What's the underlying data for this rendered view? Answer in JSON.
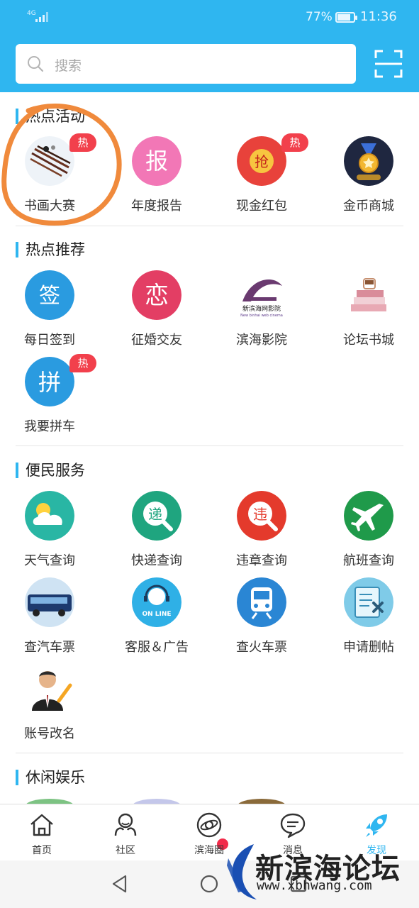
{
  "status_bar": {
    "network": "4G",
    "battery": "77%",
    "time": "11:36"
  },
  "search": {
    "placeholder": "搜索",
    "icon": "search-icon",
    "scan_icon": "scan-icon"
  },
  "sections": [
    {
      "title": "热点活动",
      "items": [
        {
          "label": "书画大赛",
          "icon": "calligraphy-brushes-icon",
          "badge": "热"
        },
        {
          "label": "年度报告",
          "icon": "report-icon",
          "glyph": "报"
        },
        {
          "label": "现金红包",
          "icon": "red-envelope-icon",
          "glyph": "抢",
          "badge": "热"
        },
        {
          "label": "金币商城",
          "icon": "gold-medal-icon"
        }
      ]
    },
    {
      "title": "热点推荐",
      "items": [
        {
          "label": "每日签到",
          "icon": "checkin-icon",
          "glyph": "签"
        },
        {
          "label": "征婚交友",
          "icon": "dating-icon",
          "glyph": "恋"
        },
        {
          "label": "滨海影院",
          "icon": "cinema-logo-icon",
          "caption": "新滨海网影院",
          "subcaption": "New binhai web cinema"
        },
        {
          "label": "论坛书城",
          "icon": "books-icon"
        },
        {
          "label": "我要拼车",
          "icon": "carpool-icon",
          "glyph": "拼",
          "badge": "热"
        }
      ]
    },
    {
      "title": "便民服务",
      "items": [
        {
          "label": "天气查询",
          "icon": "weather-icon"
        },
        {
          "label": "快递查询",
          "icon": "express-icon",
          "glyph": "递"
        },
        {
          "label": "违章查询",
          "icon": "violation-icon",
          "glyph": "违"
        },
        {
          "label": "航班查询",
          "icon": "airplane-icon"
        },
        {
          "label": "查汽车票",
          "icon": "bus-icon"
        },
        {
          "label": "客服＆广告",
          "icon": "customer-service-icon",
          "caption": "ON LINE"
        },
        {
          "label": "查火车票",
          "icon": "train-icon"
        },
        {
          "label": "申请删帖",
          "icon": "delete-post-icon"
        },
        {
          "label": "账号改名",
          "icon": "rename-account-icon"
        }
      ]
    },
    {
      "title": "休闲娱乐"
    }
  ],
  "nav": [
    {
      "label": "首页",
      "icon": "home-icon"
    },
    {
      "label": "社区",
      "icon": "community-icon"
    },
    {
      "label": "滨海圈",
      "icon": "planet-icon"
    },
    {
      "label": "消息",
      "icon": "message-icon"
    },
    {
      "label": "发现",
      "icon": "rocket-icon"
    }
  ],
  "watermark": {
    "title": "新滨海论坛",
    "url": "www.xbhwang.com"
  },
  "colors": {
    "header": "#2fb6f0",
    "hot_badge": "#f2404c",
    "annotation": "#f08a3c"
  }
}
